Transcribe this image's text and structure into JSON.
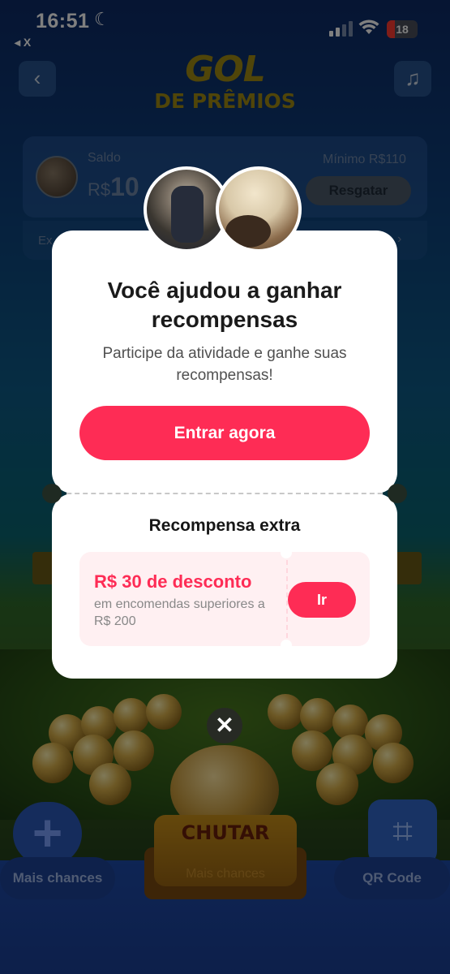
{
  "status_bar": {
    "time": "16:51",
    "back_app": "◂ X",
    "battery": "18"
  },
  "game": {
    "logo_line1": "GOL",
    "logo_line2": "DE PRÊMIOS",
    "back_icon": "chevron-left-icon",
    "music_icon": "music-note-icon",
    "balance_label": "Saldo",
    "balance_currency": "R$",
    "balance_value": "10",
    "minimum_label": "Mínimo  R$110",
    "redeem_button": "Resgatar",
    "extra_row_label": "Ex",
    "plus_button_label": "Mais chances",
    "qr_button_label": "QR Code",
    "kick_button": "CHUTAR",
    "kick_sub": "Mais chances"
  },
  "modal": {
    "title": "Você ajudou  a ganhar recompensas",
    "subtitle": "Participe da atividade e ganhe suas recompensas!",
    "cta": "Entrar agora",
    "extra_title": "Recompensa extra",
    "coupon_title": "R$ 30 de desconto",
    "coupon_sub": "em encomendas superiores a R$ 200",
    "coupon_button": "Ir",
    "close_icon": "close-icon"
  },
  "colors": {
    "accent": "#fe2c55",
    "coupon_bg": "#fff0f2"
  }
}
